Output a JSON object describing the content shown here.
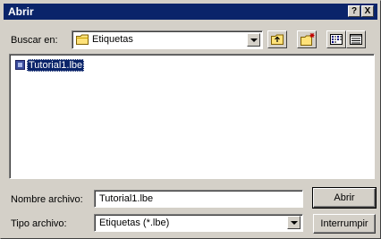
{
  "window": {
    "title": "Abrir",
    "help_label": "?",
    "close_label": "X"
  },
  "toolbar": {
    "look_in_label": "Buscar en:",
    "look_in_value": "Etiquetas",
    "buttons": [
      "up-one-level",
      "create-new-folder",
      "list-view",
      "details-view"
    ]
  },
  "file_list": {
    "items": [
      {
        "name": "Tutorial1.lbe",
        "selected": true
      }
    ]
  },
  "form": {
    "filename_label": "Nombre archivo:",
    "filename_value": "Tutorial1.lbe",
    "filetype_label": "Tipo archivo:",
    "filetype_value": "Etiquetas (*.lbe)"
  },
  "buttons": {
    "open_label": "Abrir",
    "cancel_label": "Interrumpir"
  },
  "colors": {
    "titlebar": "#0a246a",
    "selection": "#0a246a",
    "face": "#d4d0c8"
  }
}
